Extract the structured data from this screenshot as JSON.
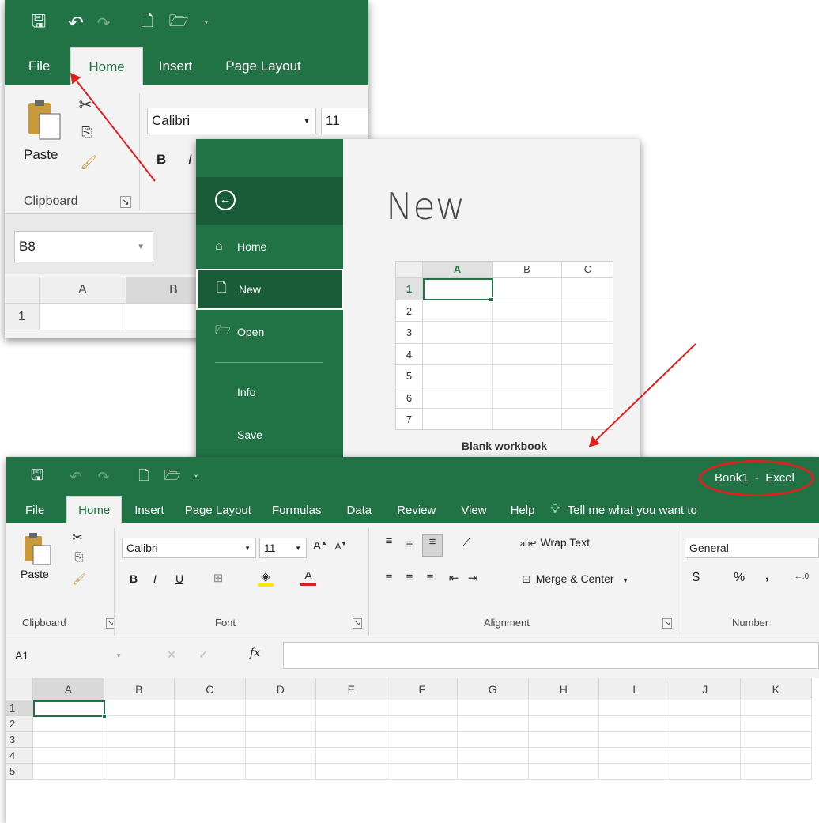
{
  "snippet1": {
    "tabs": [
      "File",
      "Home",
      "Insert",
      "Page Layout"
    ],
    "font_name": "Calibri",
    "font_size": "11",
    "paste_label": "Paste",
    "clipboard_label": "Clipboard",
    "bold": "B",
    "italic": "I",
    "name_box": "B8",
    "col_a": "A",
    "col_b": "B",
    "row_1": "1"
  },
  "backstage": {
    "nav": [
      {
        "label": "Home",
        "icon": "home-icon"
      },
      {
        "label": "New",
        "icon": "new-doc-icon"
      },
      {
        "label": "Open",
        "icon": "folder-icon"
      },
      {
        "label": "Info"
      },
      {
        "label": "Save"
      }
    ],
    "heading": "New",
    "thumb_cols": [
      "A",
      "B",
      "C"
    ],
    "thumb_rows": [
      "1",
      "2",
      "3",
      "4",
      "5",
      "6",
      "7"
    ],
    "template_label": "Blank workbook"
  },
  "excel": {
    "title": "Book1  -  Excel",
    "tabs": [
      "File",
      "Home",
      "Insert",
      "Page Layout",
      "Formulas",
      "Data",
      "Review",
      "View",
      "Help"
    ],
    "tell_me": "Tell me what you want to",
    "font_name": "Calibri",
    "font_size": "11",
    "wrap_text": "Wrap Text",
    "merge_center": "Merge & Center",
    "number_format": "General",
    "groups": {
      "clipboard": "Clipboard",
      "font": "Font",
      "alignment": "Alignment",
      "number": "Number"
    },
    "paste_label": "Paste",
    "name_box": "A1",
    "fx": "fx",
    "columns": [
      "A",
      "B",
      "C",
      "D",
      "E",
      "F",
      "G",
      "H",
      "I",
      "J",
      "K"
    ],
    "rows": [
      "1",
      "2",
      "3",
      "4",
      "5"
    ],
    "font_buttons": {
      "bold": "B",
      "italic": "I",
      "underline": "U"
    },
    "number_buttons": {
      "currency": "$",
      "percent": "%",
      "comma": ","
    }
  },
  "colors": {
    "excel_green": "#217346",
    "dark_green": "#1a5c38",
    "annotation_red": "#e0201e"
  }
}
